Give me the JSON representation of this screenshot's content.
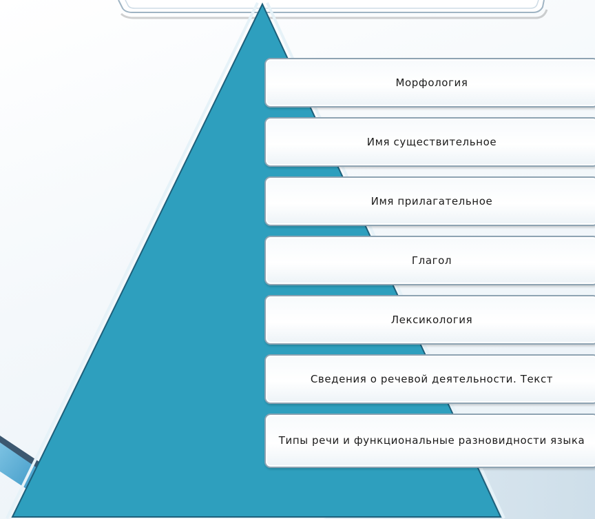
{
  "diagram": {
    "type": "pyramid-list",
    "levels": [
      {
        "label": "Морфология"
      },
      {
        "label": "Имя существительное"
      },
      {
        "label": "Имя прилагательное"
      },
      {
        "label": "Глагол"
      },
      {
        "label": "Лексикология"
      },
      {
        "label": "Сведения о речевой деятельности. Текст"
      },
      {
        "label": "Типы речи и функциональные разновидности языка"
      }
    ]
  },
  "colors": {
    "pyramid_fill": "#2e9fbe",
    "pyramid_outline": "#1d5f7a",
    "box_border": "#8ea3b2",
    "background": "#f4f8fb"
  }
}
